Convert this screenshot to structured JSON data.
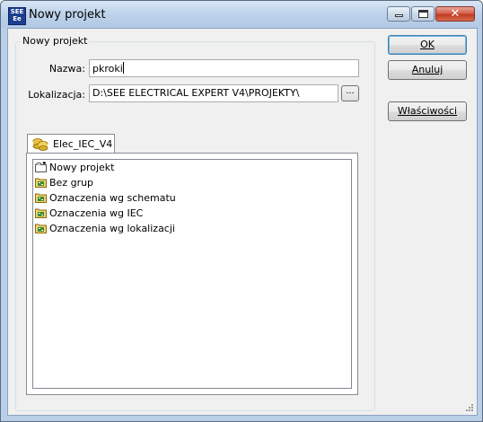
{
  "window": {
    "title": "Nowy projekt",
    "app_icon_text": [
      "SEE",
      "Ee"
    ]
  },
  "group": {
    "legend": "Nowy projekt",
    "name_label": "Nazwa:",
    "name_value": "pkroki",
    "location_label": "Lokalizacja:",
    "location_value": "D:\\SEE ELECTRICAL EXPERT V4\\PROJEKTY\\",
    "browse_label": "..."
  },
  "tab": {
    "label": "Elec_IEC_V4"
  },
  "tree": {
    "items": [
      {
        "label": "Nowy projekt",
        "icon": "new-project-folder-icon"
      },
      {
        "label": "Bez grup",
        "icon": "group-folder-icon"
      },
      {
        "label": "Oznaczenia wg schematu",
        "icon": "group-folder-icon"
      },
      {
        "label": "Oznaczenia wg IEC",
        "icon": "group-folder-icon"
      },
      {
        "label": "Oznaczenia wg lokalizacji",
        "icon": "group-folder-icon"
      }
    ]
  },
  "buttons": {
    "ok": "OK",
    "cancel": "Anuluj",
    "properties": "Właściwości"
  },
  "colors": {
    "titlebar": "#bdd2ea",
    "close_button": "#c13a22",
    "dialog_background": "#f0f0f0"
  }
}
